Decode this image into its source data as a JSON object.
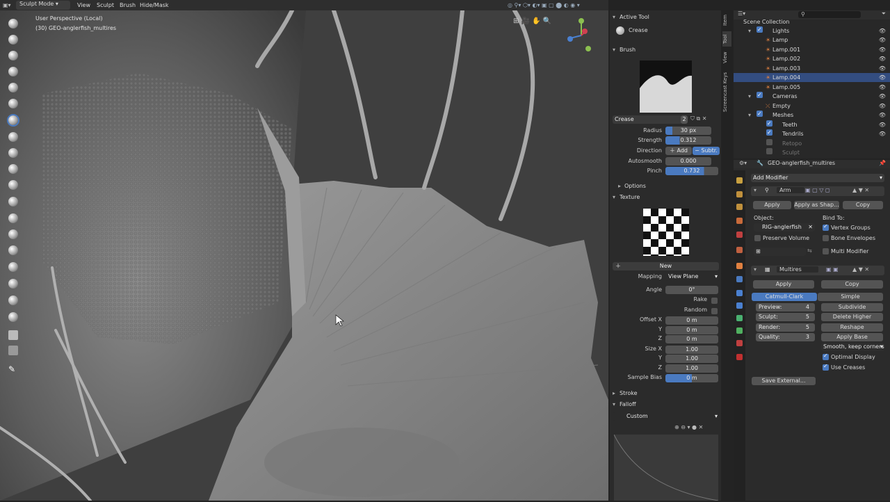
{
  "topbar": {
    "mode": "Sculpt Mode",
    "menus": [
      "View",
      "Sculpt",
      "Brush",
      "Hide/Mask"
    ]
  },
  "viewport": {
    "perspective": "User Perspective (Local)",
    "object": "(30) GEO-anglerfish_multires"
  },
  "toolpanel": {
    "active_tool_header": "Active Tool",
    "active_tool_name": "Crease",
    "brush_header": "Brush",
    "brush_name": "Crease",
    "brush_users": "2",
    "radius_label": "Radius",
    "radius_value": "30 px",
    "strength_label": "Strength",
    "strength_value": "0.312",
    "direction_label": "Direction",
    "direction_add": "Add",
    "direction_subtract": "Subtr.",
    "autosmooth_label": "Autosmooth",
    "autosmooth_value": "0.000",
    "pinch_label": "Pinch",
    "pinch_value": "0.732",
    "options_header": "Options",
    "texture_header": "Texture",
    "new_button": "New",
    "mapping_label": "Mapping",
    "mapping_value": "View Plane",
    "angle_label": "Angle",
    "angle_value": "0°",
    "rake_label": "Rake",
    "random_label": "Random",
    "offset_x_label": "Offset X",
    "offset_y_label": "Y",
    "offset_z_label": "Z",
    "offset_x": "0 m",
    "offset_y": "0 m",
    "offset_z": "0 m",
    "size_x_label": "Size X",
    "size_y_label": "Y",
    "size_z_label": "Z",
    "size_x": "1.00",
    "size_y": "1.00",
    "size_z": "1.00",
    "sample_bias_label": "Sample Bias",
    "sample_bias_value": "0 m",
    "stroke_header": "Stroke",
    "falloff_header": "Falloff",
    "falloff_preset": "Custom"
  },
  "sidetabs": [
    "Item",
    "Tool",
    "View",
    "Screencast Keys"
  ],
  "outliner": {
    "rows": [
      {
        "label": "Scene Collection"
      },
      {
        "label": "Lights"
      },
      {
        "label": "Lamp"
      },
      {
        "label": "Lamp.001"
      },
      {
        "label": "Lamp.002"
      },
      {
        "label": "Lamp.003"
      },
      {
        "label": "Lamp.004"
      },
      {
        "label": "Lamp.005"
      },
      {
        "label": "Cameras"
      },
      {
        "label": "Empty"
      },
      {
        "label": "Meshes"
      },
      {
        "label": "Teeth"
      },
      {
        "label": "Tendrils"
      },
      {
        "label": "Retopo"
      },
      {
        "label": "Sculpt"
      }
    ]
  },
  "props": {
    "object_name": "GEO-anglerfish_multires",
    "add_modifier": "Add Modifier",
    "armature": {
      "name": "Arm",
      "apply": "Apply",
      "apply_as_shape": "Apply as Shap...",
      "copy": "Copy",
      "object_label": "Object:",
      "object_value": "RIG-anglerfish",
      "bind_to_label": "Bind To:",
      "vertex_groups": "Vertex Groups",
      "preserve_volume": "Preserve Volume",
      "bone_envelopes": "Bone Envelopes",
      "multi_modifier": "Multi Modifier"
    },
    "multires": {
      "name": "Multires",
      "apply": "Apply",
      "copy": "Copy",
      "catmull_clark": "Catmull-Clark",
      "simple": "Simple",
      "preview_label": "Preview:",
      "preview_value": "4",
      "sculpt_label": "Sculpt:",
      "sculpt_value": "5",
      "render_label": "Render:",
      "render_value": "5",
      "quality_label": "Quality:",
      "quality_value": "3",
      "subdivide": "Subdivide",
      "delete_higher": "Delete Higher",
      "reshape": "Reshape",
      "apply_base": "Apply Base",
      "smooth_mode": "Smooth, keep corners",
      "optimal_display": "Optimal Display",
      "use_creases": "Use Creases",
      "save_external": "Save External..."
    }
  }
}
